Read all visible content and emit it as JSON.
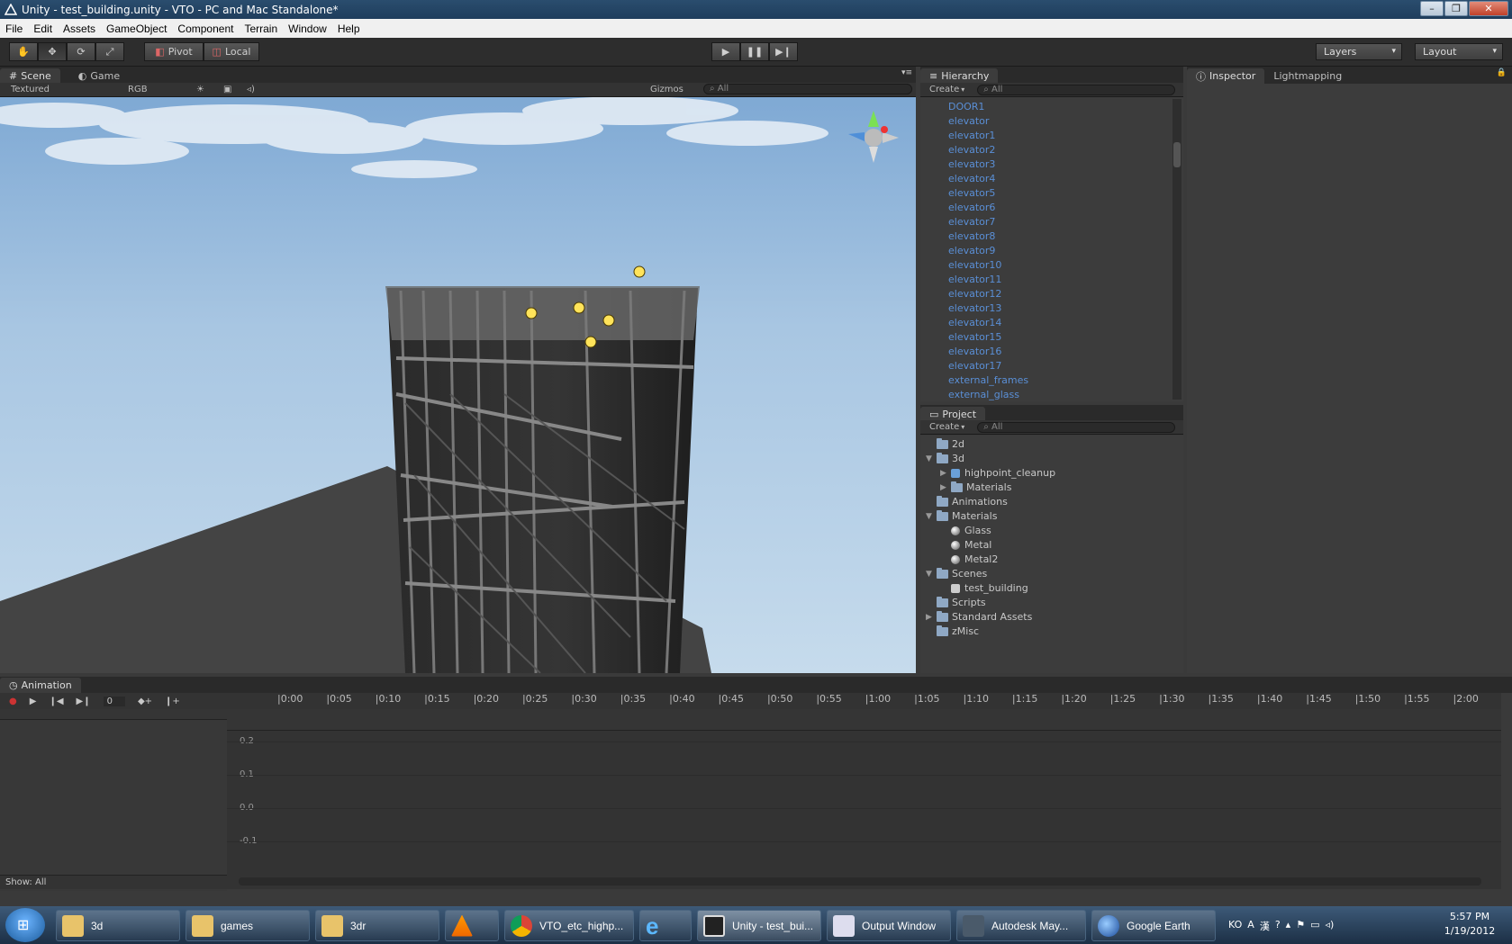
{
  "window": {
    "title": "Unity - test_building.unity - VTO - PC and Mac Standalone*",
    "min": "–",
    "max": "❐",
    "close": "✕"
  },
  "menu": [
    "File",
    "Edit",
    "Assets",
    "GameObject",
    "Component",
    "Terrain",
    "Window",
    "Help"
  ],
  "toolbar": {
    "pivot": "Pivot",
    "local": "Local",
    "layers": "Layers",
    "layout": "Layout"
  },
  "scene_panel": {
    "tabs": [
      "Scene",
      "Game"
    ],
    "render_mode": "Textured",
    "color_mode": "RGB",
    "gizmos": "Gizmos",
    "search": "All"
  },
  "hierarchy": {
    "tab": "Hierarchy",
    "create": "Create",
    "search": "All",
    "items": [
      "DOOR1",
      "elevator",
      "elevator1",
      "elevator2",
      "elevator3",
      "elevator4",
      "elevator5",
      "elevator6",
      "elevator7",
      "elevator8",
      "elevator9",
      "elevator10",
      "elevator11",
      "elevator12",
      "elevator13",
      "elevator14",
      "elevator15",
      "elevator16",
      "elevator17",
      "external_frames",
      "external_glass"
    ]
  },
  "project": {
    "tab": "Project",
    "create": "Create",
    "search": "All",
    "items": [
      {
        "label": "2d",
        "depth": 0,
        "icon": "folder",
        "arrow": ""
      },
      {
        "label": "3d",
        "depth": 0,
        "icon": "folder",
        "arrow": "▼"
      },
      {
        "label": "highpoint_cleanup",
        "depth": 1,
        "icon": "prefab",
        "arrow": "▶"
      },
      {
        "label": "Materials",
        "depth": 1,
        "icon": "folder",
        "arrow": "▶"
      },
      {
        "label": "Animations",
        "depth": 0,
        "icon": "folder",
        "arrow": ""
      },
      {
        "label": "Materials",
        "depth": 0,
        "icon": "folder",
        "arrow": "▼"
      },
      {
        "label": "Glass",
        "depth": 1,
        "icon": "sphere",
        "arrow": ""
      },
      {
        "label": "Metal",
        "depth": 1,
        "icon": "sphere",
        "arrow": ""
      },
      {
        "label": "Metal2",
        "depth": 1,
        "icon": "sphere",
        "arrow": ""
      },
      {
        "label": "Scenes",
        "depth": 0,
        "icon": "folder",
        "arrow": "▼"
      },
      {
        "label": "test_building",
        "depth": 1,
        "icon": "unity",
        "arrow": ""
      },
      {
        "label": "Scripts",
        "depth": 0,
        "icon": "folder",
        "arrow": ""
      },
      {
        "label": "Standard Assets",
        "depth": 0,
        "icon": "folder",
        "arrow": "▶"
      },
      {
        "label": "zMisc",
        "depth": 0,
        "icon": "folder",
        "arrow": ""
      }
    ]
  },
  "inspector": {
    "tabs": [
      "Inspector",
      "Lightmapping"
    ]
  },
  "animation": {
    "tab": "Animation",
    "frame": "0",
    "show": "Show: All",
    "timeline": [
      "0:00",
      "0:05",
      "0:10",
      "0:15",
      "0:20",
      "0:25",
      "0:30",
      "0:35",
      "0:40",
      "0:45",
      "0:50",
      "0:55",
      "1:00",
      "1:05",
      "1:10",
      "1:15",
      "1:20",
      "1:25",
      "1:30",
      "1:35",
      "1:40",
      "1:45",
      "1:50",
      "1:55",
      "2:00"
    ],
    "yvalues": [
      "0.2",
      "0.1",
      "0.0",
      "-0.1"
    ]
  },
  "taskbar": {
    "items": [
      "3d",
      "games",
      "3dr",
      "",
      "VTO_etc_highp...",
      "",
      "Unity - test_bui...",
      "Output Window",
      "Autodesk May...",
      "Google Earth"
    ],
    "lang": "KO",
    "time": "5:57 PM",
    "date": "1/19/2012"
  }
}
